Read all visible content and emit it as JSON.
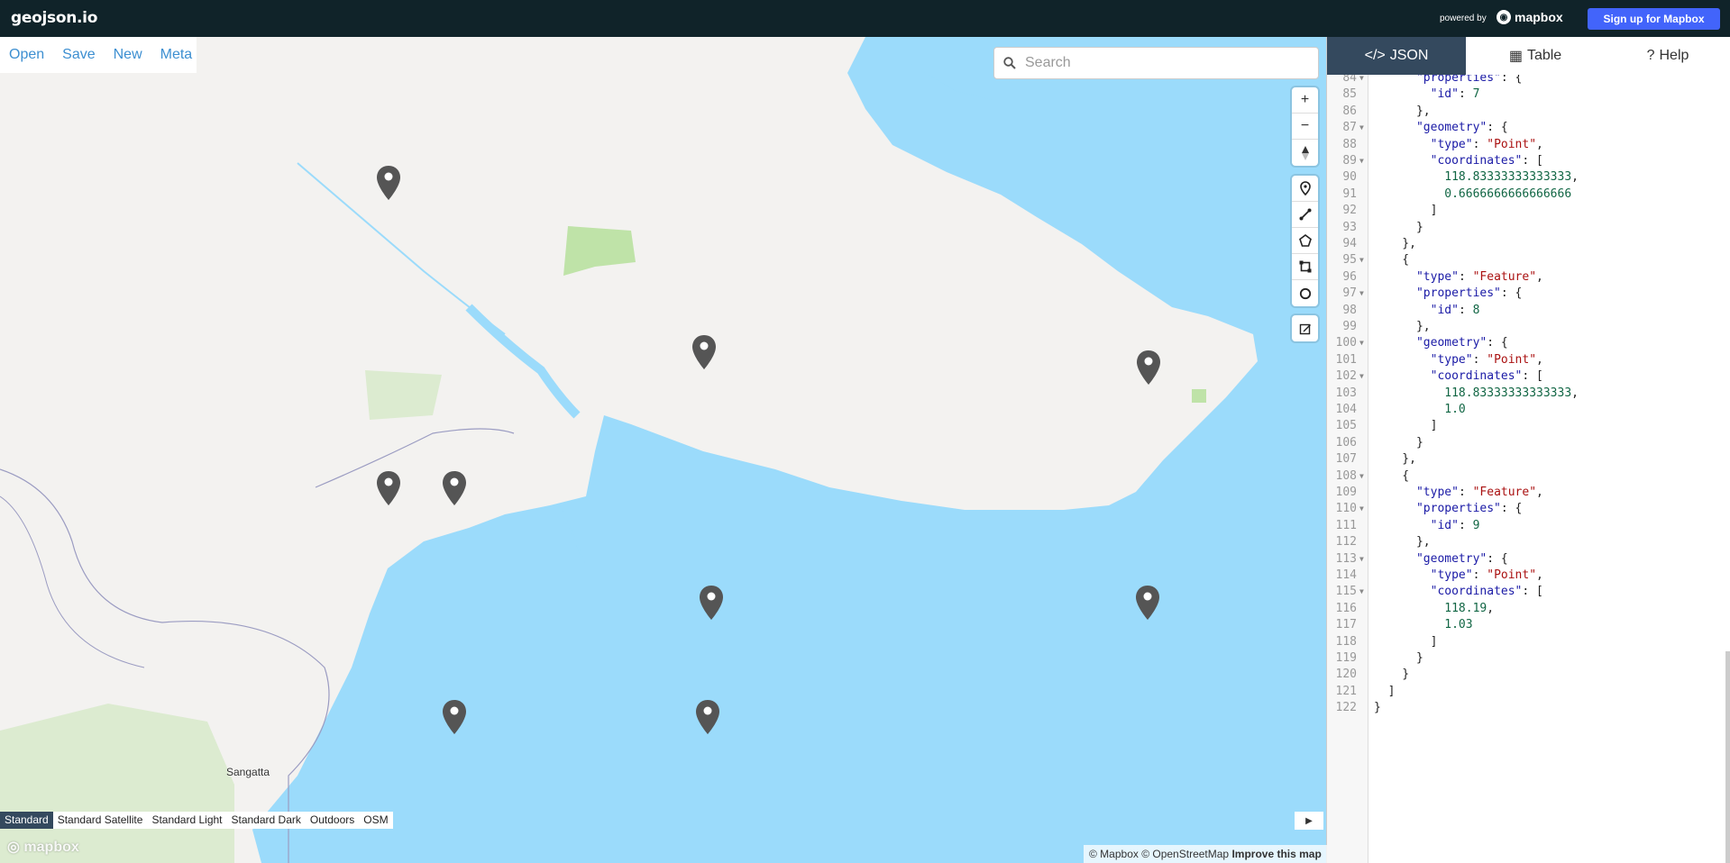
{
  "app": {
    "logo": "geojson.io",
    "powered_by": "powered by",
    "mapbox_brand": "mapbox",
    "signup_label": "Sign up for Mapbox"
  },
  "file_menu": [
    "Open",
    "Save",
    "New",
    "Meta"
  ],
  "search": {
    "placeholder": "Search",
    "value": ""
  },
  "zoom_controls": [
    "zoom-in-icon",
    "zoom-out-icon",
    "compass-icon"
  ],
  "draw_tools": [
    "marker-icon",
    "line-icon",
    "polygon-icon",
    "rectangle-icon",
    "circle-icon"
  ],
  "edit_tool": "edit-icon",
  "map_styles": {
    "items": [
      "Standard",
      "Standard Satellite",
      "Standard Light",
      "Standard Dark",
      "Outdoors",
      "OSM"
    ],
    "selected": "Standard"
  },
  "place_labels": [
    "Sangatta"
  ],
  "watermark": "mapbox",
  "attribution": {
    "text": "© Mapbox © OpenStreetMap",
    "improve": "Improve this map"
  },
  "colors": {
    "topbar": "#102329",
    "signup": "#4264fb",
    "water": "#9bdbfb",
    "land": "#f3f2f0",
    "park": "#bfe3a8",
    "pin": "#555555",
    "active_tab": "#34495e",
    "menu_link": "#3d8fd1"
  },
  "tabs": [
    {
      "label": "JSON",
      "icon": "code-icon",
      "active": true
    },
    {
      "label": "Table",
      "icon": "table-icon",
      "active": false
    },
    {
      "label": "Help",
      "icon": "help-icon",
      "active": false
    }
  ],
  "editor": {
    "lines": [
      {
        "n": "84",
        "fold": true,
        "text": "      \"properties\": {"
      },
      {
        "n": "85",
        "fold": false,
        "text": "        \"id\": 7"
      },
      {
        "n": "86",
        "fold": false,
        "text": "      },"
      },
      {
        "n": "87",
        "fold": true,
        "text": "      \"geometry\": {"
      },
      {
        "n": "88",
        "fold": false,
        "text": "        \"type\": \"Point\","
      },
      {
        "n": "89",
        "fold": true,
        "text": "        \"coordinates\": ["
      },
      {
        "n": "90",
        "fold": false,
        "text": "          118.83333333333333,"
      },
      {
        "n": "91",
        "fold": false,
        "text": "          0.6666666666666666"
      },
      {
        "n": "92",
        "fold": false,
        "text": "        ]"
      },
      {
        "n": "93",
        "fold": false,
        "text": "      }"
      },
      {
        "n": "94",
        "fold": false,
        "text": "    },"
      },
      {
        "n": "95",
        "fold": true,
        "text": "    {"
      },
      {
        "n": "96",
        "fold": false,
        "text": "      \"type\": \"Feature\","
      },
      {
        "n": "97",
        "fold": true,
        "text": "      \"properties\": {"
      },
      {
        "n": "98",
        "fold": false,
        "text": "        \"id\": 8"
      },
      {
        "n": "99",
        "fold": false,
        "text": "      },"
      },
      {
        "n": "100",
        "fold": true,
        "text": "      \"geometry\": {"
      },
      {
        "n": "101",
        "fold": false,
        "text": "        \"type\": \"Point\","
      },
      {
        "n": "102",
        "fold": true,
        "text": "        \"coordinates\": ["
      },
      {
        "n": "103",
        "fold": false,
        "text": "          118.83333333333333,"
      },
      {
        "n": "104",
        "fold": false,
        "text": "          1.0"
      },
      {
        "n": "105",
        "fold": false,
        "text": "        ]"
      },
      {
        "n": "106",
        "fold": false,
        "text": "      }"
      },
      {
        "n": "107",
        "fold": false,
        "text": "    },"
      },
      {
        "n": "108",
        "fold": true,
        "text": "    {"
      },
      {
        "n": "109",
        "fold": false,
        "text": "      \"type\": \"Feature\","
      },
      {
        "n": "110",
        "fold": true,
        "text": "      \"properties\": {"
      },
      {
        "n": "111",
        "fold": false,
        "text": "        \"id\": 9"
      },
      {
        "n": "112",
        "fold": false,
        "text": "      },"
      },
      {
        "n": "113",
        "fold": true,
        "text": "      \"geometry\": {"
      },
      {
        "n": "114",
        "fold": false,
        "text": "        \"type\": \"Point\","
      },
      {
        "n": "115",
        "fold": true,
        "text": "        \"coordinates\": ["
      },
      {
        "n": "116",
        "fold": false,
        "text": "          118.19,"
      },
      {
        "n": "117",
        "fold": false,
        "text": "          1.03"
      },
      {
        "n": "118",
        "fold": false,
        "text": "        ]"
      },
      {
        "n": "119",
        "fold": false,
        "text": "      }"
      },
      {
        "n": "120",
        "fold": false,
        "text": "    }"
      },
      {
        "n": "121",
        "fold": false,
        "text": "  ]"
      },
      {
        "n": "122",
        "fold": false,
        "text": "}"
      }
    ]
  }
}
